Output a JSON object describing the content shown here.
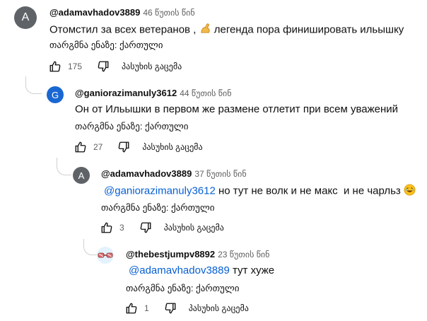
{
  "comments": [
    {
      "avatar_letter": "A",
      "avatar_color": "#5f6368",
      "author": "@adamavhadov3889",
      "time": "46 წუთის წინ",
      "text_before": "Отомстил за всех ветеранов ,",
      "emoji": "flexed-biceps",
      "text_after": " легенда пора финишировать ильышку",
      "translate": "თარგმნა ენაზე: ქართული",
      "likes": "175",
      "reply": "პასუხის გაცემა"
    },
    {
      "avatar_letter": "G",
      "avatar_color": "#1967d2",
      "author": "@ganiorazimanuly3612",
      "time": "44 წუთის წინ",
      "text": "Он от Ильышки в первом же размене отлетит при всем уважений",
      "translate": "თარგმნა ენაზე: ქართული",
      "likes": "27",
      "reply": "პასუხის გაცემა"
    },
    {
      "avatar_letter": "A",
      "avatar_color": "#5f6368",
      "author": "@adamavhadov3889",
      "time": "37 წუთის წინ",
      "mention": "@ganiorazimanuly3612",
      "text": " но тут не волк и не макс  и не чарльз",
      "emoji": "laughing-face",
      "translate": "თარგმნა ენაზე: ქართული",
      "likes": "3",
      "reply": "პასუხის გაცემა"
    },
    {
      "avatar_color": "#e3f2fd",
      "author": "@thebestjumpv8892",
      "time": "23 წუთის წინ",
      "mention": "@adamavhadov3889",
      "text": " тут хуже",
      "translate": "თარგმნა ენაზე: ქართული",
      "likes": "1",
      "reply": "პასუხის გაცემა"
    }
  ],
  "colors": {
    "mention": "#065fd4",
    "secondary": "#606060",
    "thread_line": "#d0d0d0"
  },
  "icons": {
    "like": "thumb-up-icon",
    "dislike": "thumb-down-icon"
  }
}
